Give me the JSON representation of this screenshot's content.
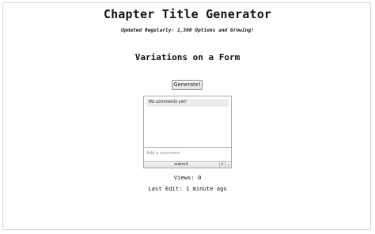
{
  "header": {
    "title": "Chapter Title Generator",
    "tagline": "Updated Regularly: 1,300 Options and Growing!"
  },
  "generated_title": "Variations on a Form",
  "generate_button_label": "Generate!",
  "comments": {
    "empty_message": "No comments yet!",
    "input_placeholder": "Add a comment",
    "submit_label": "submit",
    "settings_icon": "gear-icon",
    "sort_icon": "up-down-icon"
  },
  "stats": {
    "views": "Views: 0",
    "last_edit": "Last Edit: 1 minute ago"
  }
}
